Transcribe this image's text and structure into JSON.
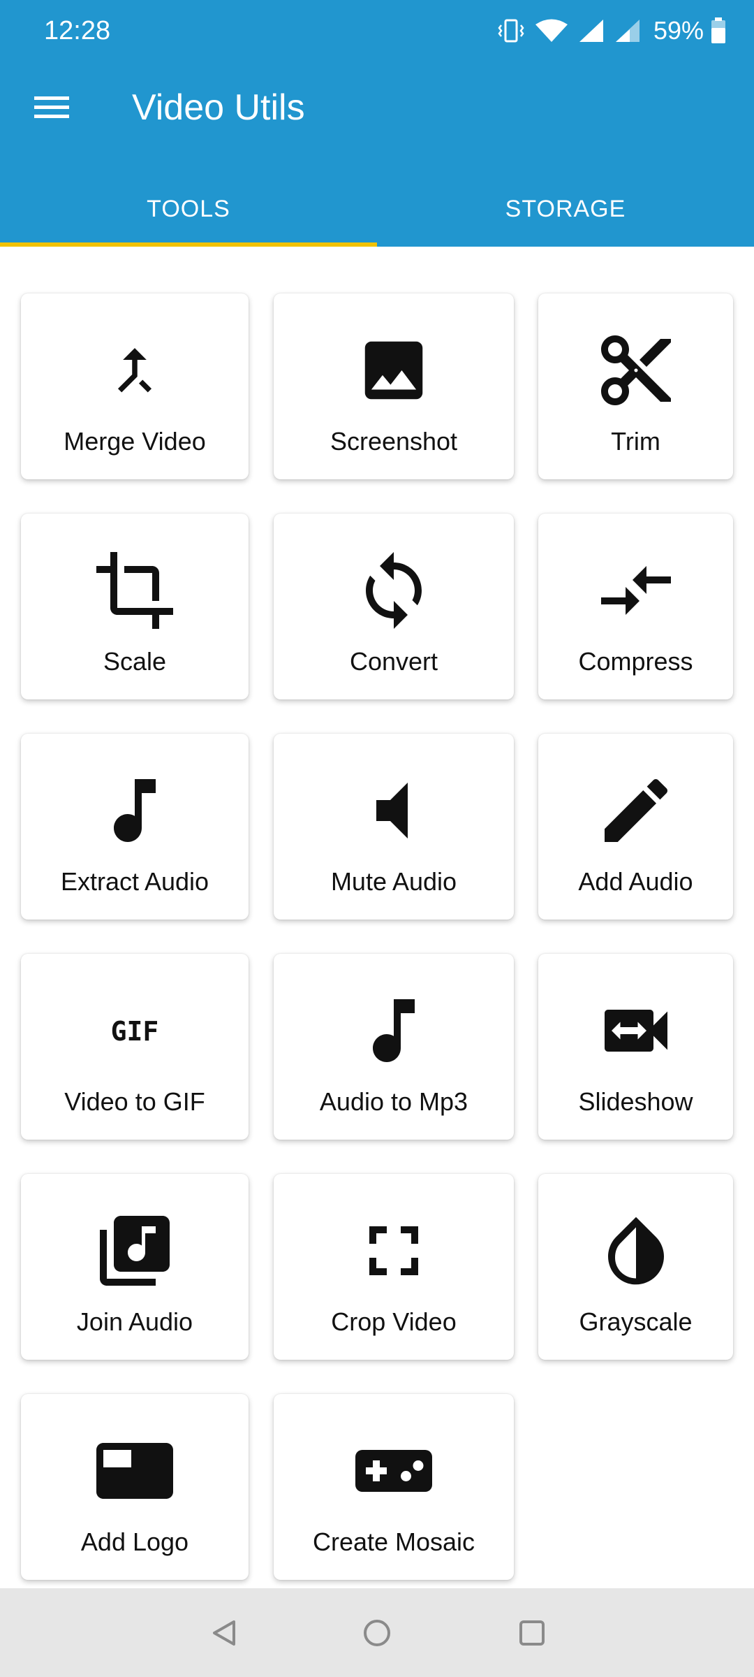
{
  "status_bar": {
    "time": "12:28",
    "battery_percent": "59%",
    "icons": [
      "vibrate-icon",
      "wifi-icon",
      "signal-icon",
      "signal-icon",
      "battery-icon"
    ]
  },
  "app_bar": {
    "menu_icon": "hamburger-menu-icon",
    "title": "Video Utils"
  },
  "tabs": [
    {
      "label": "TOOLS",
      "active": true
    },
    {
      "label": "STORAGE",
      "active": false
    }
  ],
  "tools": [
    {
      "label": "Merge Video",
      "icon": "merge-icon"
    },
    {
      "label": "Screenshot",
      "icon": "image-icon"
    },
    {
      "label": "Trim",
      "icon": "scissors-icon"
    },
    {
      "label": "Scale",
      "icon": "crop-icon"
    },
    {
      "label": "Convert",
      "icon": "sync-icon"
    },
    {
      "label": "Compress",
      "icon": "compare-arrows-icon"
    },
    {
      "label": "Extract Audio",
      "icon": "music-note-icon"
    },
    {
      "label": "Mute Audio",
      "icon": "speaker-mute-icon"
    },
    {
      "label": "Add Audio",
      "icon": "pencil-icon"
    },
    {
      "label": "Video to GIF",
      "icon": "gif-icon"
    },
    {
      "label": "Audio to Mp3",
      "icon": "music-note-icon"
    },
    {
      "label": "Slideshow",
      "icon": "video-camera-arrows-icon"
    },
    {
      "label": "Join Audio",
      "icon": "library-music-icon"
    },
    {
      "label": "Crop Video",
      "icon": "fullscreen-icon"
    },
    {
      "label": "Grayscale",
      "icon": "contrast-drop-icon"
    },
    {
      "label": "Add Logo",
      "icon": "picture-in-picture-icon"
    },
    {
      "label": "Create Mosaic",
      "icon": "gamepad-icon"
    }
  ],
  "gif_icon_text": "GIF",
  "nav_bar": [
    "back-icon",
    "home-icon",
    "recents-icon"
  ],
  "colors": {
    "app_bar": "#2196cf",
    "tab_indicator": "#f2c200",
    "nav_bar": "#e6e6e6"
  }
}
